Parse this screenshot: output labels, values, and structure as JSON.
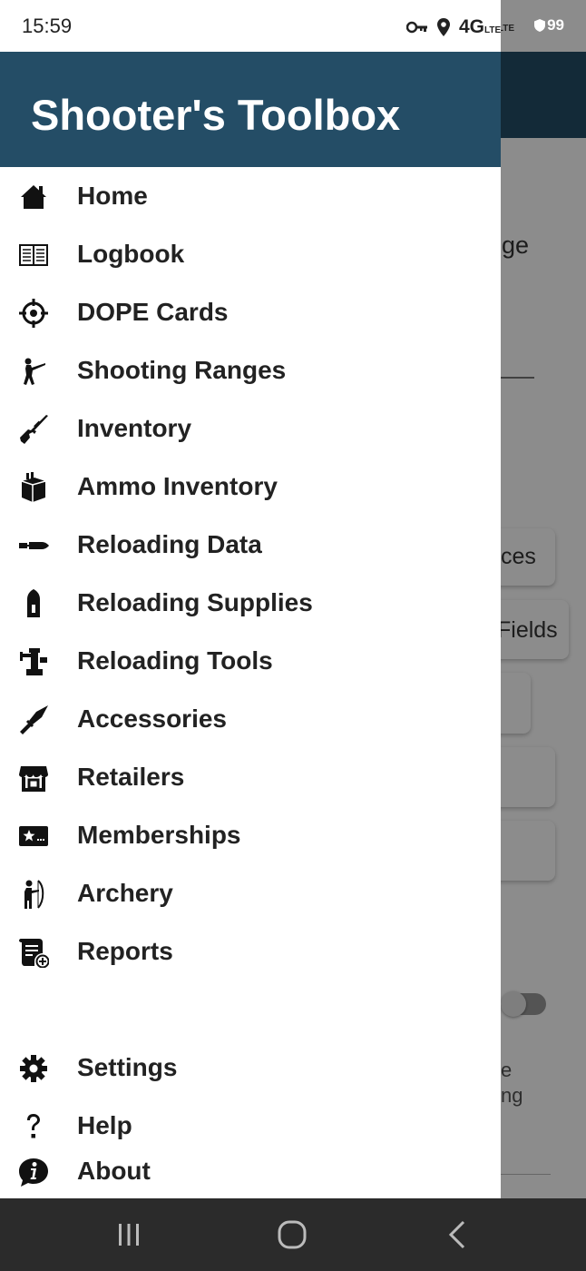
{
  "status_bar": {
    "time": "15:59",
    "network": "4G",
    "network_sub": "LTE",
    "battery": "99"
  },
  "background": {
    "text_fragments": [
      "ge",
      "ces",
      "Fields",
      "e",
      "ng"
    ]
  },
  "drawer": {
    "title": "Shooter's Toolbox",
    "items": [
      {
        "label": "Home",
        "icon": "home-icon"
      },
      {
        "label": "Logbook",
        "icon": "logbook-icon"
      },
      {
        "label": "DOPE Cards",
        "icon": "crosshair-icon"
      },
      {
        "label": "Shooting Ranges",
        "icon": "shooter-icon"
      },
      {
        "label": "Inventory",
        "icon": "rifle-icon"
      },
      {
        "label": "Ammo Inventory",
        "icon": "ammo-box-icon"
      },
      {
        "label": "Reloading Data",
        "icon": "bullet-icon"
      },
      {
        "label": "Reloading Supplies",
        "icon": "cartridge-icon"
      },
      {
        "label": "Reloading Tools",
        "icon": "press-icon"
      },
      {
        "label": "Accessories",
        "icon": "knife-icon"
      },
      {
        "label": "Retailers",
        "icon": "store-icon"
      },
      {
        "label": "Memberships",
        "icon": "membership-card-icon"
      },
      {
        "label": "Archery",
        "icon": "archer-icon"
      },
      {
        "label": "Reports",
        "icon": "report-icon"
      },
      {
        "label": "Settings",
        "icon": "gear-icon"
      },
      {
        "label": "Help",
        "icon": "question-icon"
      },
      {
        "label": "About",
        "icon": "info-icon"
      }
    ]
  },
  "colors": {
    "header": "#244d66",
    "text": "#222222",
    "nav_bar": "#2b2b2b"
  }
}
